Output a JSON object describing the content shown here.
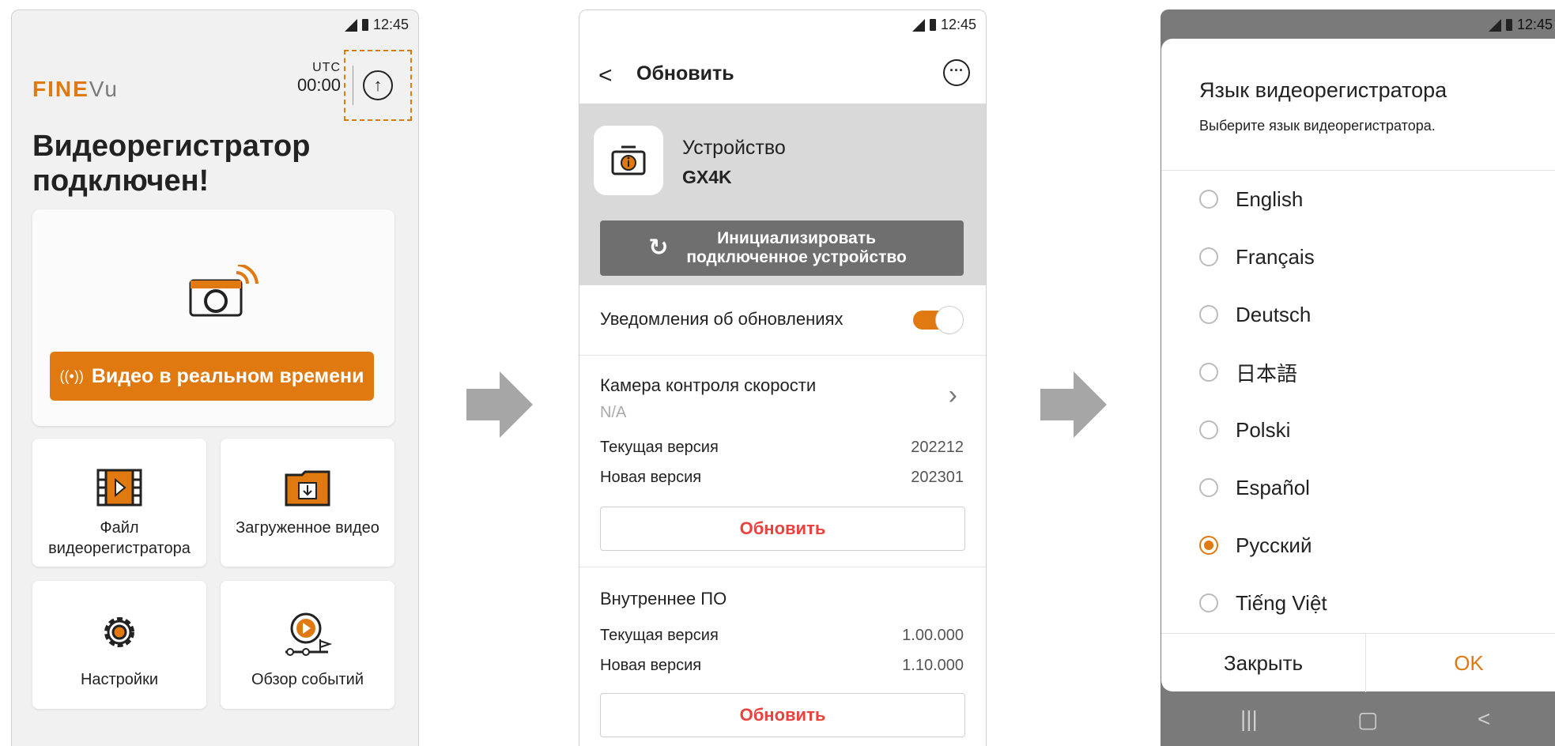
{
  "status": {
    "time": "12:45"
  },
  "screen1": {
    "logo_fine": "FINE",
    "logo_vu": "Vu",
    "utc_label": "UTC",
    "utc_time": "00:00",
    "title": "Видеорегистратор подключен!",
    "live_button": "Видео в реальном времени",
    "live_wave": "((•))",
    "tiles": [
      {
        "label": "Файл видеорегистратора",
        "icon": "film-icon"
      },
      {
        "label": "Загруженное видео",
        "icon": "download-folder-icon"
      },
      {
        "label": "Настройки",
        "icon": "gear-icon"
      },
      {
        "label": "Обзор событий",
        "icon": "event-review-icon"
      }
    ]
  },
  "screen2": {
    "title": "Обновить",
    "device_label": "Устройство",
    "device_model": "GX4K",
    "init_button": "Инициализировать подключенное устройство",
    "notifications_label": "Уведомления об обновлениях",
    "notifications_on": true,
    "sections": [
      {
        "name": "Камера контроля скорости",
        "status": "N/A",
        "current_label": "Текущая версия",
        "current": "202212",
        "new_label": "Новая версия",
        "new": "202301",
        "button": "Обновить"
      },
      {
        "name": "Внутреннее ПО",
        "current_label": "Текущая версия",
        "current": "1.00.000",
        "new_label": "Новая версия",
        "new": "1.10.000",
        "button": "Обновить"
      }
    ]
  },
  "screen3": {
    "title": "Язык видеорегистратора",
    "subtitle": "Выберите язык видеорегистратора.",
    "options": [
      "English",
      "Français",
      "Deutsch",
      "日本語",
      "Polski",
      "Español",
      "Русский",
      "Tiếng Việt"
    ],
    "selected": "Русский",
    "close_button": "Закрыть",
    "ok_button": "OK",
    "nav": {
      "recent": "|||",
      "home": "▢",
      "back": "<"
    }
  },
  "colors": {
    "accent": "#e07a10",
    "update_red": "#e8433f",
    "grey_panel": "#d9d9d9"
  }
}
